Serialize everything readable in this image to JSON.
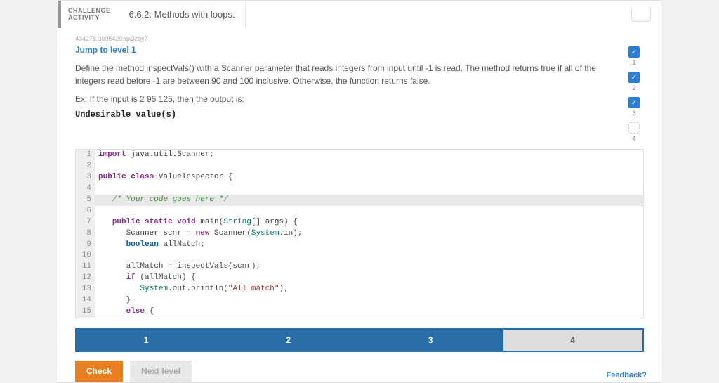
{
  "header": {
    "label1": "CHALLENGE",
    "label2": "ACTIVITY",
    "title": "6.6.2: Methods with loops."
  },
  "hash": "434278.3005420.qx3zqy7",
  "jump": "Jump to level 1",
  "description": "Define the method inspectVals() with a Scanner parameter that reads integers from input until -1 is read. The method returns true if all of the integers read before -1 are between 90 and 100 inclusive. Otherwise, the function returns false.",
  "example_prefix": "Ex: If the input is 2 95 125, then the output is:",
  "output": "Undesirable value(s)",
  "code": {
    "l1_kw": "import",
    "l1_rest": " java.util.Scanner;",
    "l3_kw": "public class",
    "l3_name": " ValueInspector {",
    "l5_cmt": "/* Your code goes here */",
    "l7_kw": "public static void",
    "l7_name": " main(",
    "l7_type": "String",
    "l7_rest": "[] args) {",
    "l8a": "      Scanner scnr = ",
    "l8_kw": "new",
    "l8b": " Scanner(",
    "l8_type": "System",
    "l8c": ".in);",
    "l9_kw": "boolean",
    "l9_rest": " allMatch;",
    "l11": "      allMatch = inspectVals(scnr);",
    "l12_kw": "if",
    "l12_rest": " (allMatch) {",
    "l13a": "         ",
    "l13_type": "System",
    "l13b": ".out.println(",
    "l13_str": "\"All match\"",
    "l13c": ");",
    "l14": "      }",
    "l15_kw": "else",
    "l15_rest": " {"
  },
  "steps": [
    "1",
    "2",
    "3",
    "4"
  ],
  "buttons": {
    "check": "Check",
    "next": "Next level"
  },
  "feedback": "Feedback?",
  "progress": [
    {
      "checked": true,
      "num": "1"
    },
    {
      "checked": true,
      "num": "2"
    },
    {
      "checked": true,
      "num": "3"
    },
    {
      "checked": false,
      "num": "4"
    }
  ]
}
